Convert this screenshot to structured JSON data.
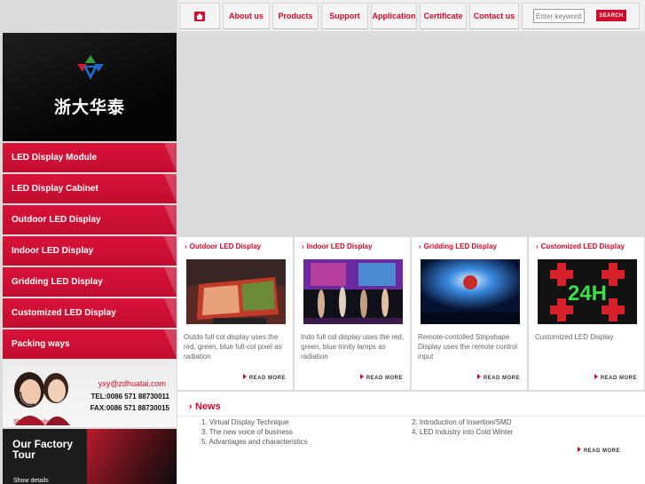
{
  "nav": {
    "items": [
      {
        "label": "About us"
      },
      {
        "label": "Products"
      },
      {
        "label": "Support"
      },
      {
        "label": "Application"
      },
      {
        "label": "Certificate"
      },
      {
        "label": "Contact us"
      }
    ],
    "search_placeholder": "Enter keywords",
    "search_label": "SEARCH",
    "home_icon": "home-icon"
  },
  "logo": {
    "text": "浙大华泰"
  },
  "sidebar": {
    "items": [
      {
        "label": "LED Display Module"
      },
      {
        "label": "LED Display Cabinet"
      },
      {
        "label": "Outdoor LED Display"
      },
      {
        "label": "Indoor LED Display"
      },
      {
        "label": "Gridding LED Display"
      },
      {
        "label": "Customized LED Display"
      },
      {
        "label": "Packing ways"
      }
    ]
  },
  "contact": {
    "email": "yxy@zdhuatai.com",
    "tel": "TEL:0086  571  88730011",
    "fax": "FAX:0086  571  88730015",
    "details": "Show details"
  },
  "factory": {
    "title": "Our Factory Tour",
    "details": "Show details"
  },
  "products": [
    {
      "title": "Outdoor LED Display",
      "desc": "Outdo full col display uses the red, green, blue full-col pixel as radiation",
      "more": "READ MORE"
    },
    {
      "title": "Indoor LED Display",
      "desc": "Indo full col display uses the red, green, blue trinity lamps as radiation",
      "more": "READ MORE"
    },
    {
      "title": "Gridding LED Display",
      "desc": "Remote-contolled Stripshape Display uses the remote control input",
      "more": "READ MORE"
    },
    {
      "title": "Customized LED Display",
      "desc": "Customized LED Display",
      "more": "READ MORE",
      "image_text": "24H"
    }
  ],
  "news": {
    "title": "News",
    "left": [
      "1. Virtual Display Technique",
      "3. The new voice of business",
      "5. Advantages and characteristics"
    ],
    "right": [
      "2. Introduction of Insertion/SMD",
      "4. LED Industry into Cold Winter"
    ],
    "more": "READ MORE"
  },
  "colors": {
    "accent": "#cc0a2a",
    "background": "#dcdcdc"
  }
}
